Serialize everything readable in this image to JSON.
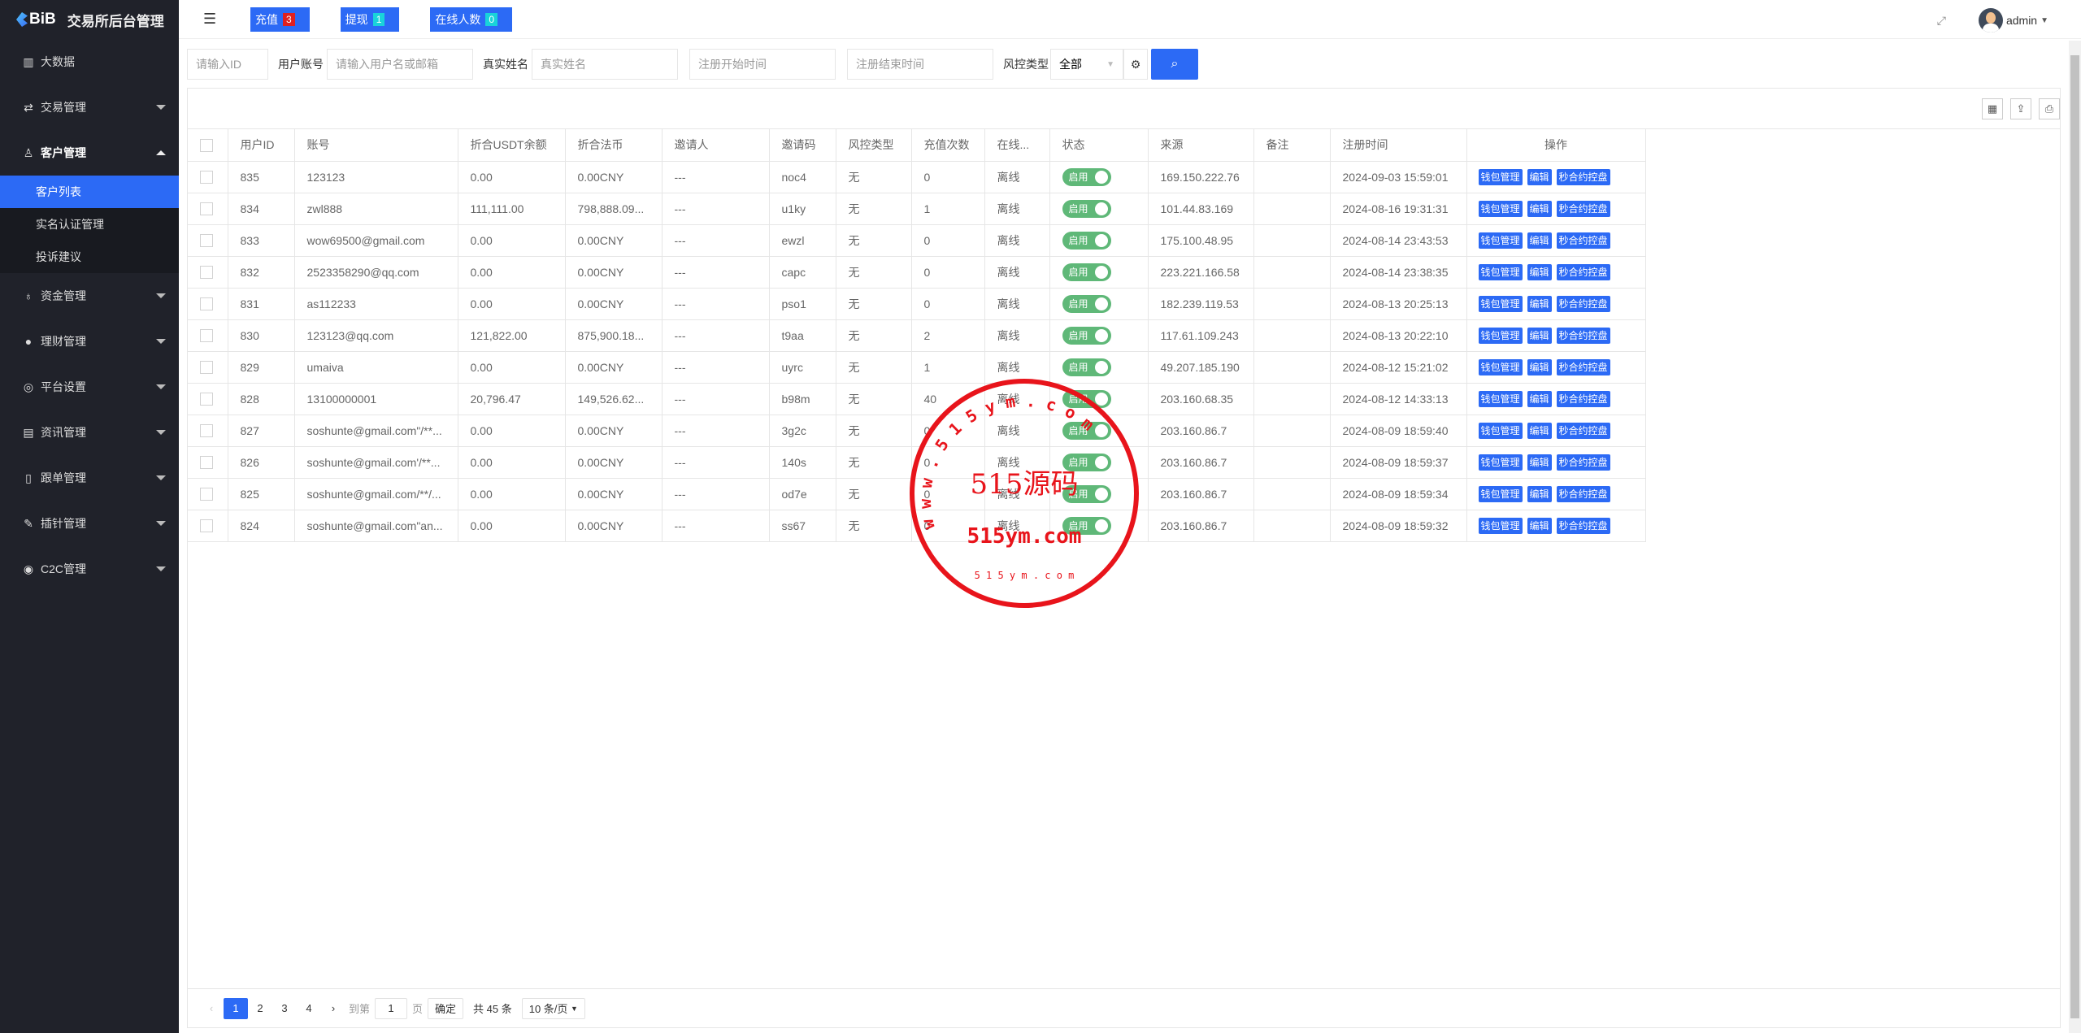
{
  "app": {
    "logo_text": "BiB",
    "title": "交易所后台管理"
  },
  "sidebar": {
    "items": [
      {
        "label": "大数据",
        "icon": "chart-icon"
      },
      {
        "label": "交易管理",
        "icon": "exchange-icon"
      },
      {
        "label": "客户管理",
        "icon": "user-icon",
        "expanded": true,
        "children": [
          "客户列表",
          "实名认证管理",
          "投诉建议"
        ]
      },
      {
        "label": "资金管理",
        "icon": "money-bag-icon"
      },
      {
        "label": "理财管理",
        "icon": "piggy-bank-icon"
      },
      {
        "label": "平台设置",
        "icon": "settings-icon"
      },
      {
        "label": "资讯管理",
        "icon": "news-icon"
      },
      {
        "label": "跟单管理",
        "icon": "document-icon"
      },
      {
        "label": "插针管理",
        "icon": "pin-icon"
      },
      {
        "label": "C2C管理",
        "icon": "c2c-icon"
      }
    ],
    "active_child": "客户列表"
  },
  "topbar": {
    "stats": [
      {
        "label": "充值",
        "count": "3",
        "color": "#e02020"
      },
      {
        "label": "提现",
        "count": "1",
        "color": "#19d3da"
      },
      {
        "label": "在线人数",
        "count": "0",
        "color": "#19d3da"
      }
    ],
    "user": "admin"
  },
  "filters": {
    "id_placeholder": "请输入ID",
    "account_label": "用户账号",
    "account_placeholder": "请输入用户名或邮箱",
    "name_label": "真实姓名",
    "name_placeholder": "真实姓名",
    "start_placeholder": "注册开始时间",
    "end_placeholder": "注册结束时间",
    "risk_label": "风控类型",
    "risk_value": "全部"
  },
  "table": {
    "headers": [
      "用户ID",
      "账号",
      "折合USDT余额",
      "折合法币",
      "邀请人",
      "邀请码",
      "风控类型",
      "充值次数",
      "在线...",
      "状态",
      "来源",
      "备注",
      "注册时间",
      "操作"
    ],
    "switch_label": "启用",
    "actions": [
      "钱包管理",
      "编辑",
      "秒合约控盘"
    ],
    "rows": [
      [
        "835",
        "123123",
        "0.00",
        "0.00CNY",
        "---",
        "noc4",
        "无",
        "0",
        "离线",
        "169.150.222.76",
        "",
        "2024-09-03 15:59:01"
      ],
      [
        "834",
        "zwl888",
        "111,111.00",
        "798,888.09...",
        "---",
        "u1ky",
        "无",
        "1",
        "离线",
        "101.44.83.169",
        "",
        "2024-08-16 19:31:31"
      ],
      [
        "833",
        "wow69500@gmail.com",
        "0.00",
        "0.00CNY",
        "---",
        "ewzl",
        "无",
        "0",
        "离线",
        "175.100.48.95",
        "",
        "2024-08-14 23:43:53"
      ],
      [
        "832",
        "2523358290@qq.com",
        "0.00",
        "0.00CNY",
        "---",
        "capc",
        "无",
        "0",
        "离线",
        "223.221.166.58",
        "",
        "2024-08-14 23:38:35"
      ],
      [
        "831",
        "as112233",
        "0.00",
        "0.00CNY",
        "---",
        "pso1",
        "无",
        "0",
        "离线",
        "182.239.119.53",
        "",
        "2024-08-13 20:25:13"
      ],
      [
        "830",
        "123123@qq.com",
        "121,822.00",
        "875,900.18...",
        "---",
        "t9aa",
        "无",
        "2",
        "离线",
        "117.61.109.243",
        "",
        "2024-08-13 20:22:10"
      ],
      [
        "829",
        "umaiva",
        "0.00",
        "0.00CNY",
        "---",
        "uyrc",
        "无",
        "1",
        "离线",
        "49.207.185.190",
        "",
        "2024-08-12 15:21:02"
      ],
      [
        "828",
        "13100000001",
        "20,796.47",
        "149,526.62...",
        "---",
        "b98m",
        "无",
        "40",
        "离线",
        "203.160.68.35",
        "",
        "2024-08-12 14:33:13"
      ],
      [
        "827",
        "soshunte@gmail.com\"/**...",
        "0.00",
        "0.00CNY",
        "---",
        "3g2c",
        "无",
        "0",
        "离线",
        "203.160.86.7",
        "",
        "2024-08-09 18:59:40"
      ],
      [
        "826",
        "soshunte@gmail.com'/**...",
        "0.00",
        "0.00CNY",
        "---",
        "140s",
        "无",
        "0",
        "离线",
        "203.160.86.7",
        "",
        "2024-08-09 18:59:37"
      ],
      [
        "825",
        "soshunte@gmail.com/**/...",
        "0.00",
        "0.00CNY",
        "---",
        "od7e",
        "无",
        "0",
        "离线",
        "203.160.86.7",
        "",
        "2024-08-09 18:59:34"
      ],
      [
        "824",
        "soshunte@gmail.com\"an...",
        "0.00",
        "0.00CNY",
        "---",
        "ss67",
        "无",
        "0",
        "离线",
        "203.160.86.7",
        "",
        "2024-08-09 18:59:32"
      ]
    ]
  },
  "pagination": {
    "pages": [
      "1",
      "2",
      "3",
      "4"
    ],
    "current": "1",
    "goto_label": "到第",
    "goto_value": "1",
    "page_suffix": "页",
    "confirm": "确定",
    "total": "共 45 条",
    "page_size": "10 条/页"
  },
  "watermark": {
    "center": "515源码",
    "url": "515ym.com",
    "ring": "w w w . 5 1 5 y m . c o m",
    "bottom": "5 1 5 y m . c o m",
    "color": "#e8141b"
  }
}
